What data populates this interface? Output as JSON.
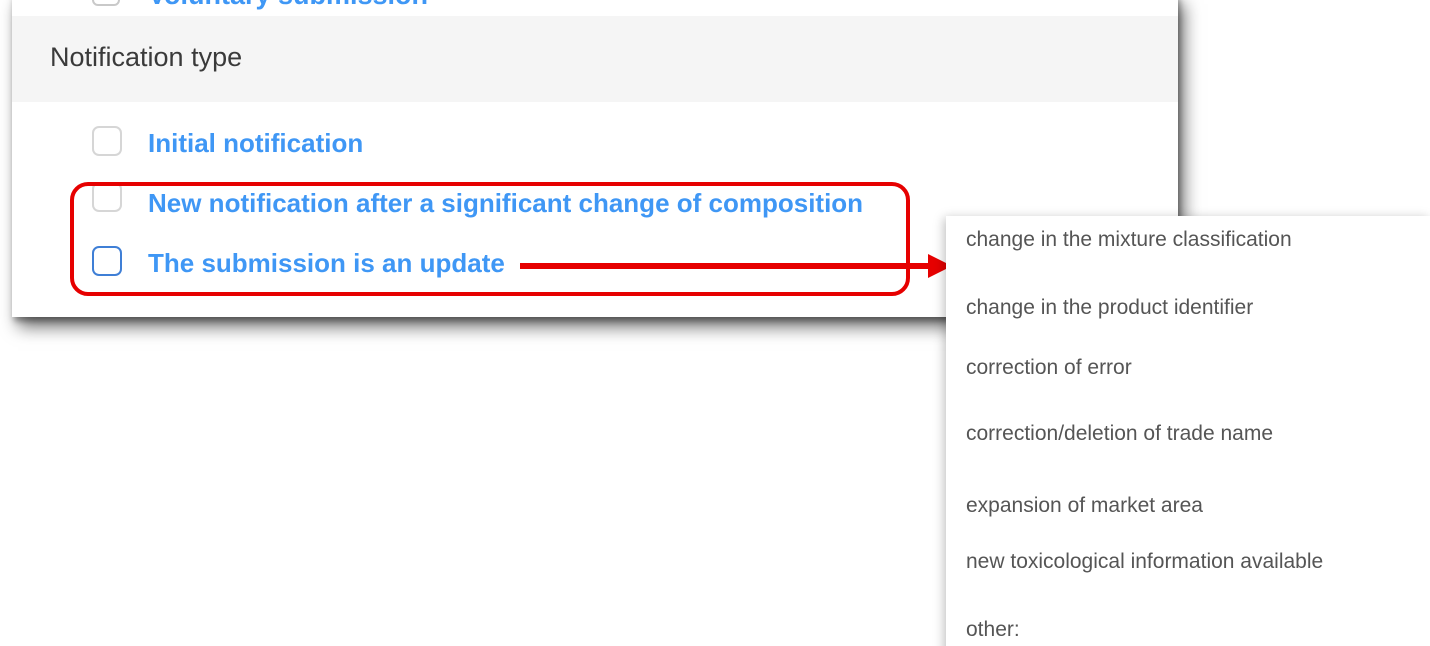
{
  "previous_option": {
    "label": "Voluntary submission"
  },
  "section": {
    "title": "Notification type"
  },
  "options": [
    {
      "label": "Initial notification",
      "checked": false
    },
    {
      "label": "New notification after a significant change of composition",
      "checked": false
    },
    {
      "label": "The submission is an update",
      "checked": false
    }
  ],
  "update_reasons": [
    "change in the mixture classification",
    "change in the product identifier",
    "correction of error",
    "correction/deletion of trade name",
    "expansion of market area",
    "new toxicological information available",
    "other:"
  ],
  "colors": {
    "link_blue": "#3f97f5",
    "highlight_red": "#e60000",
    "header_bg": "#f5f5f5",
    "reason_text": "#555555"
  }
}
